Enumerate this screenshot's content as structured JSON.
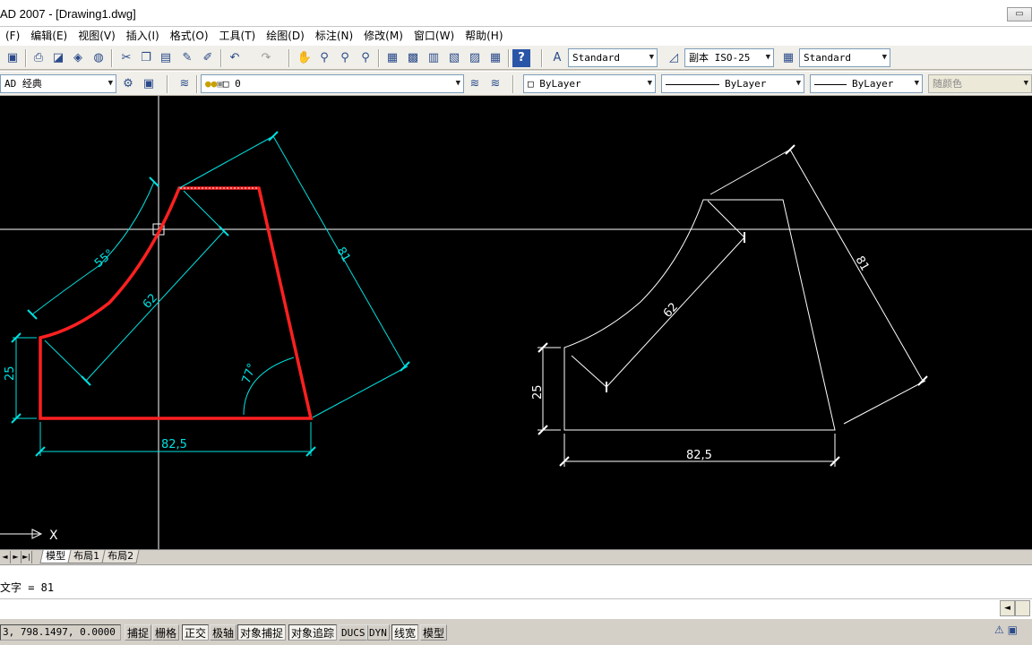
{
  "window": {
    "title": "AD 2007 - [Drawing1.dwg]",
    "buttons": [
      "▭",
      "",
      ""
    ]
  },
  "menu": {
    "items": [
      "(F)",
      "编辑(E)",
      "视图(V)",
      "插入(I)",
      "格式(O)",
      "工具(T)",
      "绘图(D)",
      "标注(N)",
      "修改(M)",
      "窗口(W)",
      "帮助(H)"
    ]
  },
  "toolbar1": {
    "icons": [
      "save-icon",
      "print-icon",
      "preview-icon",
      "publish-icon",
      "globe-icon",
      "cut-icon",
      "copy-icon",
      "paste-icon",
      "matchprop-icon",
      "brush-icon",
      "undo-icon",
      "redo-icon",
      "pan-icon",
      "zoom-realtime-icon",
      "zoom-window-icon",
      "zoom-previous-icon",
      "properties-icon",
      "design-center-icon",
      "tool-palettes-icon",
      "sheet-set-icon",
      "markup-icon",
      "calculator-icon",
      "help-icon"
    ],
    "text_style": "Standard",
    "dim_style": "副本 ISO-25",
    "table_style": "Standard"
  },
  "toolbar2": {
    "workspace": "AD 经典",
    "layer": "0",
    "color": "ByLayer",
    "linetype": "ByLayer",
    "lineweight": "ByLayer",
    "plotstyle": "随颜色"
  },
  "tabs": {
    "nav": [
      "◄",
      "►",
      "►|"
    ],
    "items": [
      "模型",
      "布局1",
      "布局2"
    ],
    "active": "模型"
  },
  "drawing": {
    "dims_left": {
      "arc_angle": "55°",
      "radius": "62",
      "slant": "81",
      "height": "25",
      "angle": "77°",
      "width": "82,5"
    },
    "dims_right": {
      "radius": "62",
      "slant": "81",
      "height": "25",
      "width": "82,5"
    },
    "ucs_label": "X",
    "colors": {
      "background": "#000000",
      "selected": "#ff2020",
      "dimension": "#00e0e0",
      "geometry": "#ffffff",
      "crosshair": "#ffffff"
    }
  },
  "command": {
    "history": "文字 = 81",
    "prompt": ""
  },
  "status": {
    "coords": "3, 798.1497, 0.0000",
    "buttons": [
      "捕捉",
      "栅格",
      "正交",
      "极轴",
      "对象捕捉",
      "对象追踪",
      "DUCS",
      "DYN",
      "线宽",
      "模型"
    ]
  }
}
